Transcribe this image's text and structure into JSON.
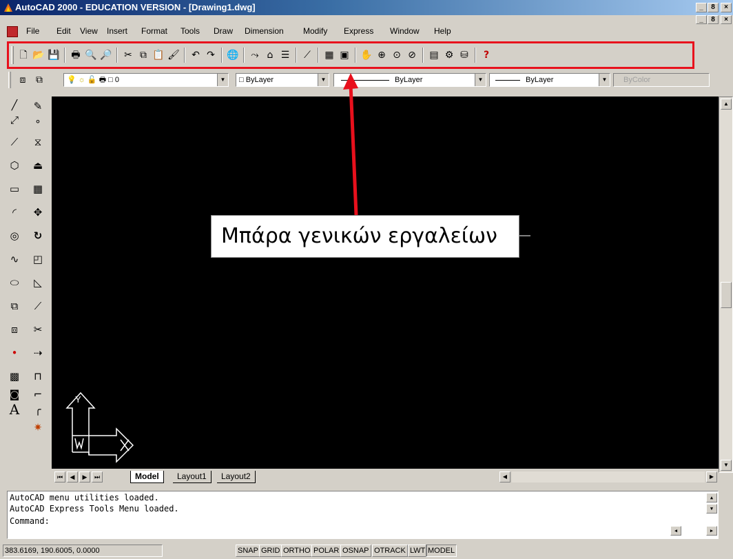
{
  "window": {
    "title": "AutoCAD 2000 - EDUCATION VERSION - [Drawing1.dwg]",
    "caption_buttons": [
      "_",
      "8",
      "×"
    ]
  },
  "menubar": {
    "items": [
      "File",
      "Edit",
      "View",
      "Insert",
      "Format",
      "Tools",
      "Draw",
      "Dimension",
      "Modify",
      "Express",
      "Window",
      "Help"
    ]
  },
  "standard_toolbar": {
    "highlight_color": "#e8101c",
    "buttons": [
      {
        "name": "new-icon",
        "glyph": "🗋"
      },
      {
        "name": "open-icon",
        "glyph": "📂"
      },
      {
        "name": "save-icon",
        "glyph": "💾"
      },
      {
        "name": "print-icon",
        "glyph": "🖶"
      },
      {
        "name": "print-preview-icon",
        "glyph": "🔍"
      },
      {
        "name": "find-icon",
        "glyph": "🔎"
      },
      {
        "name": "cut-icon",
        "glyph": "✂"
      },
      {
        "name": "copy-icon",
        "glyph": "⧉"
      },
      {
        "name": "paste-icon",
        "glyph": "📋"
      },
      {
        "name": "match-properties-icon",
        "glyph": "🖌"
      },
      {
        "name": "undo-icon",
        "glyph": "↶"
      },
      {
        "name": "redo-icon",
        "glyph": "↷"
      },
      {
        "name": "web-icon",
        "glyph": "🌐"
      },
      {
        "name": "insert-hyperlink-icon",
        "glyph": "⤳"
      },
      {
        "name": "object-snap-icon",
        "glyph": "⌂"
      },
      {
        "name": "ucs-icon",
        "glyph": "☰"
      },
      {
        "name": "distance-icon",
        "glyph": "⟋"
      },
      {
        "name": "aerial-view-icon",
        "glyph": "▦"
      },
      {
        "name": "named-views-icon",
        "glyph": "▣"
      },
      {
        "name": "pan-icon",
        "glyph": "✋"
      },
      {
        "name": "zoom-realtime-icon",
        "glyph": "⊕"
      },
      {
        "name": "zoom-window-icon",
        "glyph": "⊙"
      },
      {
        "name": "zoom-previous-icon",
        "glyph": "⊘"
      },
      {
        "name": "properties-icon",
        "glyph": "▤"
      },
      {
        "name": "design-center-icon",
        "glyph": "⚙"
      },
      {
        "name": "dbconnect-icon",
        "glyph": "⛁"
      },
      {
        "name": "help-icon",
        "glyph": "?"
      }
    ]
  },
  "properties_bar": {
    "layer": "0",
    "color": "ByLayer",
    "linetype": "ByLayer",
    "lineweight": "ByLayer",
    "plotstyle": "ByColor"
  },
  "draw_tools": [
    {
      "name": "line-icon",
      "glyph": "╱"
    },
    {
      "name": "construction-line-icon",
      "glyph": "⤢"
    },
    {
      "name": "polyline-icon",
      "glyph": "⟋"
    },
    {
      "name": "polygon-icon",
      "glyph": "⬡"
    },
    {
      "name": "rectangle-icon",
      "glyph": "▭"
    },
    {
      "name": "arc-icon",
      "glyph": "◜"
    },
    {
      "name": "circle-icon",
      "glyph": "◎"
    },
    {
      "name": "spline-icon",
      "glyph": "∿"
    },
    {
      "name": "ellipse-icon",
      "glyph": "⬭"
    },
    {
      "name": "insert-block-icon",
      "glyph": "⧉"
    },
    {
      "name": "make-block-icon",
      "glyph": "⧈"
    },
    {
      "name": "point-icon",
      "glyph": "•"
    },
    {
      "name": "hatch-icon",
      "glyph": "▩"
    },
    {
      "name": "region-icon",
      "glyph": "◙"
    },
    {
      "name": "multiline-text-icon",
      "glyph": "A"
    }
  ],
  "modify_tools": [
    {
      "name": "erase-icon",
      "glyph": "✎"
    },
    {
      "name": "copy-object-icon",
      "glyph": "∘"
    },
    {
      "name": "mirror-icon",
      "glyph": "⧖"
    },
    {
      "name": "offset-icon",
      "glyph": "⏏"
    },
    {
      "name": "array-icon",
      "glyph": "▦"
    },
    {
      "name": "move-icon",
      "glyph": "✥"
    },
    {
      "name": "rotate-icon",
      "glyph": "↻"
    },
    {
      "name": "scale-icon",
      "glyph": "◰"
    },
    {
      "name": "stretch-icon",
      "glyph": "◺"
    },
    {
      "name": "lengthen-icon",
      "glyph": "⟋"
    },
    {
      "name": "trim-icon",
      "glyph": "✂"
    },
    {
      "name": "extend-icon",
      "glyph": "⇢"
    },
    {
      "name": "break-icon",
      "glyph": "⊓"
    },
    {
      "name": "chamfer-icon",
      "glyph": "⌐"
    },
    {
      "name": "fillet-icon",
      "glyph": "╭"
    },
    {
      "name": "explode-icon",
      "glyph": "✷"
    }
  ],
  "canvas": {
    "background": "#000000",
    "ucs_y_label": "Y",
    "ucs_w_label": "W"
  },
  "callout": {
    "text": "Μπάρα γενικών εργαλείων",
    "arrow_color": "#e8101c"
  },
  "layout_tabs": {
    "nav_glyphs": [
      "⏮",
      "◀",
      "▶",
      "⏭"
    ],
    "tabs": [
      "Model",
      "Layout1",
      "Layout2"
    ]
  },
  "command": {
    "lines": [
      "AutoCAD menu utilities loaded.",
      "AutoCAD Express Tools Menu loaded."
    ],
    "prompt": "Command:"
  },
  "status": {
    "coordinates": "383.6169, 190.6005, 0.0000",
    "toggles": [
      "SNAP",
      "GRID",
      "ORTHO",
      "POLAR",
      "OSNAP",
      "OTRACK",
      "LWT",
      "MODEL"
    ]
  }
}
